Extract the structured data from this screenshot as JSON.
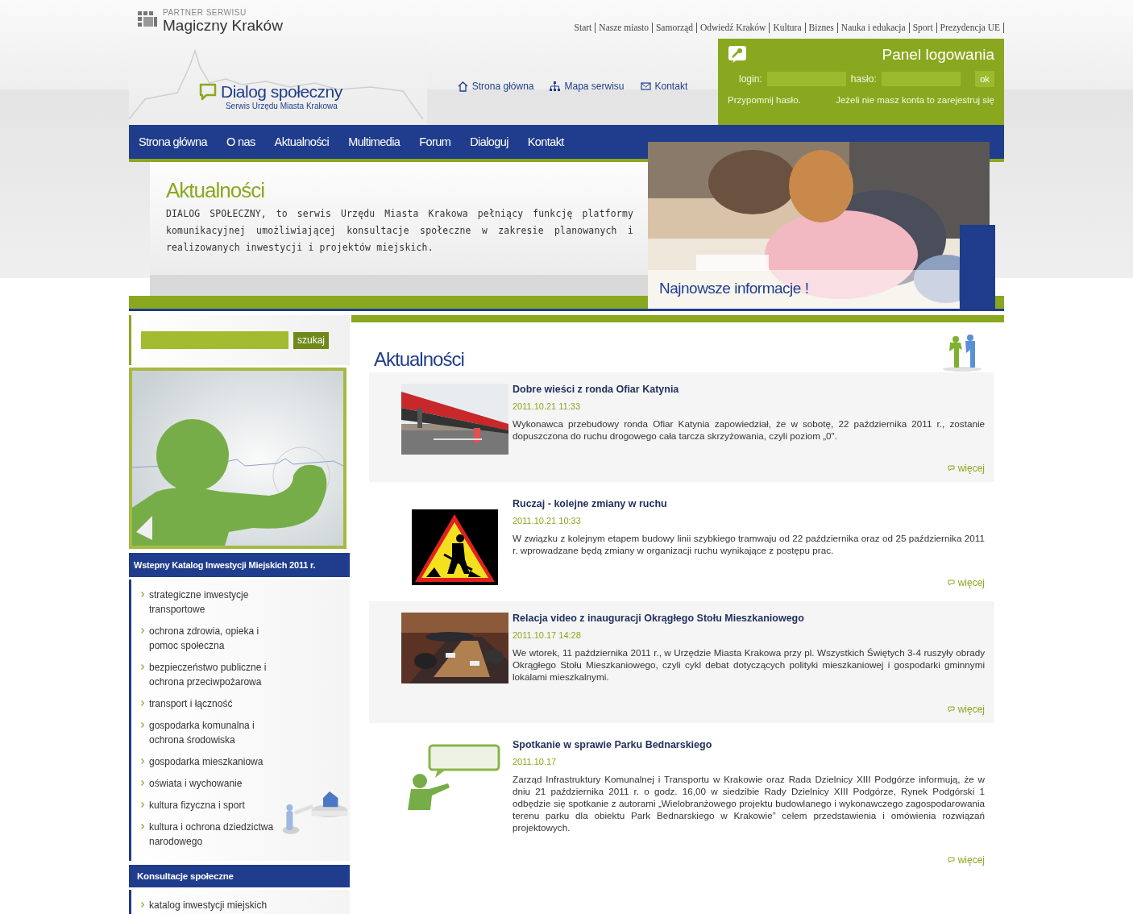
{
  "partner": {
    "label": "PARTNER SERWISU",
    "name": "Magiczny Kraków"
  },
  "top_links": [
    "Start",
    "Nasze miasto",
    "Samorząd",
    "Odwiedź Kraków",
    "Kultura",
    "Biznes",
    "Nauka i edukacja",
    "Sport",
    "Prezydencja UE"
  ],
  "logo": {
    "title": "Dialog społeczny",
    "subtitle": "Serwis Urzędu Miasta Krakowa"
  },
  "quick_links": [
    {
      "label": "Strona główna",
      "kind": "home"
    },
    {
      "label": "Mapa serwisu",
      "kind": "sitemap"
    },
    {
      "label": "Kontakt",
      "kind": "mail"
    }
  ],
  "login_panel": {
    "title": "Panel logowania",
    "login_label": "login:",
    "password_label": "hasło:",
    "submit": "ok",
    "remind": "Przypomnij hasło.",
    "register": "Jeżeli nie masz konta to zarejestruj się"
  },
  "nav": [
    "Strona główna",
    "O nas",
    "Aktualności",
    "Multimedia",
    "Forum",
    "Dialoguj",
    "Kontakt"
  ],
  "hero": {
    "title": "Aktualności",
    "text": "DIALOG SPOŁECZNY, to serwis Urzędu Miasta Krakowa pełniący funkcję platformy komunikacyjnej umożliwiającej konsultacje społeczne w zakresie planowanych i realizowanych inwestycji i projektów miejskich.",
    "caption": "Najnowsze informacje !"
  },
  "search": {
    "button": "szukaj"
  },
  "sidebar_sections": [
    {
      "title": "Wstepny Katalog Inwestycji Miejskich 2011 r.",
      "items": [
        "strategiczne inwestycje transportowe",
        "ochrona zdrowia, opieka i pomoc społeczna",
        "bezpieczeństwo publiczne i ochrona przeciwpożarowa",
        "transport i łączność",
        "gospodarka komunalna i ochrona środowiska",
        "gospodarka mieszkaniowa",
        "oświata i wychowanie",
        "kultura fizyczna i sport",
        "kultura i ochrona dziedzictwa narodowego"
      ]
    },
    {
      "title": "Konsultacje społeczne",
      "items": [
        "katalog inwestycji miejskich"
      ]
    }
  ],
  "news": {
    "title": "Aktualności",
    "items": [
      {
        "title": "Dobre wieści z ronda Ofiar Katynia",
        "date": "2011.10.21 11:33",
        "text": "Wykonawca przebudowy ronda Ofiar Katynia zapowiedział, że w sobotę, 22 października 2011 r., zostanie dopuszczona do ruchu drogowego cała tarcza skrzyżowania, czyli poziom „0\".",
        "more": "więcej"
      },
      {
        "title": "Ruczaj - kolejne zmiany w ruchu",
        "date": "2011.10.21 10:33",
        "text": "W związku z kolejnym etapem budowy linii szybkiego tramwaju od 22 października oraz od 25 października 2011 r. wprowadzane będą zmiany w organizacji ruchu wynikające z postępu prac.",
        "more": "więcej"
      },
      {
        "title": "Relacja video z inauguracji Okrągłego Stołu Mieszkaniowego",
        "date": "2011.10.17 14:28",
        "text": "We wtorek, 11 października 2011 r., w Urzędzie Miasta Krakowa przy pl. Wszystkich Świętych 3-4 ruszyły obrady Okrągłego Stołu Mieszkaniowego, czyli cykl debat dotyczących polityki mieszkaniowej i gospodarki gminnymi lokalami mieszkalnymi.",
        "more": "więcej"
      },
      {
        "title": "Spotkanie w sprawie Parku Bednarskiego",
        "date": "2011.10.17",
        "text": "Zarząd Infrastruktury Komunalnej i Transportu w Krakowie oraz Rada Dzielnicy XIII Podgórze informują, że w dniu 21 października 2011 r. o godz. 16,00 w siedzibie Rady Dzielnicy XIII Podgórze, Rynek Podgórski 1 odbędzie się spotkanie z autorami „Wielobranżowego projektu budowlanego i wykonawczego zagospodarowania terenu parku dla obiektu Park Bednarskiego w Krakowie” celem przedstawienia i omówienia rozwiązań projektowych.",
        "more": "więcej"
      }
    ]
  }
}
